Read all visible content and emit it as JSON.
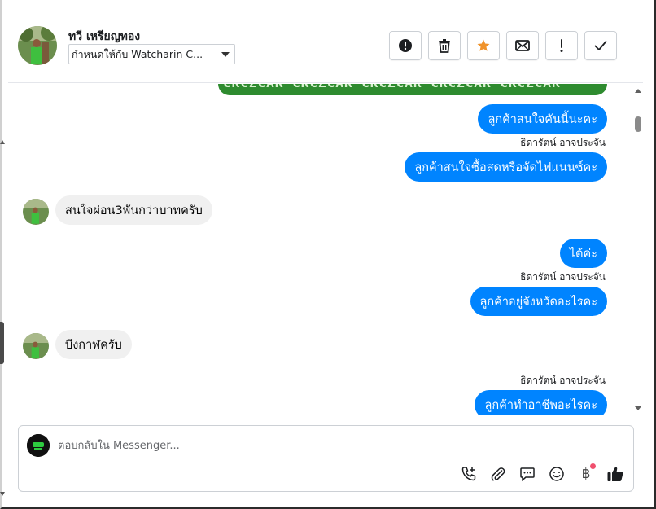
{
  "header": {
    "contact_name": "ทวี เหรียญทอง",
    "assign_label": "กำหนดให้กับ Watcharin C...",
    "actions": [
      {
        "name": "spam-alert-button",
        "icon": "alert-circle-icon"
      },
      {
        "name": "delete-button",
        "icon": "trash-icon"
      },
      {
        "name": "star-button",
        "icon": "star-icon",
        "color": "#f0932b"
      },
      {
        "name": "mark-unread-button",
        "icon": "envelope-icon"
      },
      {
        "name": "follow-up-button",
        "icon": "exclamation-icon"
      },
      {
        "name": "mark-done-button",
        "icon": "check-icon"
      }
    ]
  },
  "banner": {
    "text": "CKCZCAR CKCZCAR CKCZCAR CKCZCAR CKCZCAR"
  },
  "messages": [
    {
      "direction": "out",
      "text": "ลูกค้าสนใจคันนี้นะคะ"
    },
    {
      "direction": "out",
      "sender": "ธิดารัตน์ อาจประจัน",
      "text": "ลูกค้าสนใจซื้อสดหรือจัดไฟแนนซ์คะ"
    },
    {
      "direction": "in",
      "text": "สนใจผ่อน3พันกว่าบาทครับ"
    },
    {
      "direction": "out",
      "text": "ได้ค่ะ"
    },
    {
      "direction": "out",
      "sender": "ธิดารัตน์ อาจประจัน",
      "text": "ลูกค้าอยู่จังหวัดอะไรคะ"
    },
    {
      "direction": "in",
      "text": "บึงกาฬครับ"
    },
    {
      "direction": "out",
      "sender": "ธิดารัตน์ อาจประจัน",
      "text": "ลูกค้าทำอาชีพอะไรคะ"
    }
  ],
  "composer": {
    "placeholder": "ตอบกลับใน Messenger...",
    "tools": [
      "call-add-icon",
      "paperclip-icon",
      "saved-reply-icon",
      "emoji-icon",
      "baht-payment-icon",
      "thumbs-up-icon"
    ],
    "baht_symbol": "฿"
  },
  "colors": {
    "outgoing_bubble": "#0084ff",
    "incoming_bubble": "#f0f0f0",
    "banner_green": "#2e8b2f",
    "notification_dot": "#f0506e"
  }
}
